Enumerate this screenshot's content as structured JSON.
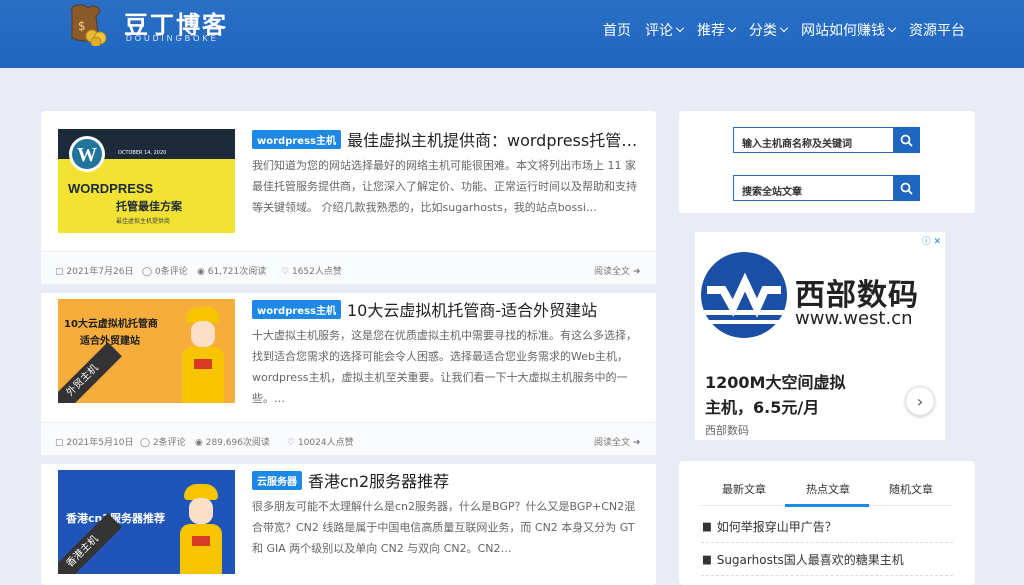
{
  "header": {
    "logo_title": "豆丁博客",
    "logo_sub": "DOUDINGBOKE",
    "nav": [
      {
        "label": "首页",
        "dropdown": false
      },
      {
        "label": "评论",
        "dropdown": true
      },
      {
        "label": "推荐",
        "dropdown": true
      },
      {
        "label": "分类",
        "dropdown": true
      },
      {
        "label": "网站如何赚钱",
        "dropdown": true
      },
      {
        "label": "资源平台",
        "dropdown": false
      }
    ]
  },
  "posts": [
    {
      "category": "wordpress主机",
      "title": "最佳虚拟主机提供商：wordpress托管最…",
      "excerpt": "我们知道为您的网站选择最好的网络主机可能很困难。本文将列出市场上 11 家最佳托管服务提供商，让您深入了解定价、功能、正常运行时间以及帮助和支持等关键领域。 介绍几款我熟悉的，比如sugarhosts，我的站点bossi…",
      "thumb": {
        "line1": "WORDPRESS",
        "line2": "托管最佳方案",
        "small_top": "OCTOBER 14, 2020",
        "small_bottom": "最佳虚拟主机提供商"
      },
      "date": "2021年7月26日",
      "comments": "0条评论",
      "views": "61,721次阅读",
      "likes": "1652人点赞",
      "read_more": "阅读全文"
    },
    {
      "category": "wordpress主机",
      "title": "10大云虚拟机托管商-适合外贸建站",
      "excerpt": "十大虚拟主机服务，这是您在优质虚拟主机中需要寻找的标准。有这么多选择，找到适合您需求的选择可能会令人困惑。选择最适合您业务需求的Web主机，wordpress主机，虚拟主机至关重要。让我们看一下十大虚拟主机服务中的一些。…",
      "thumb": {
        "line1": "10大云虚拟机托管商",
        "line2": "适合外贸建站",
        "ribbon": "外贸主机"
      },
      "date": "2021年5月10日",
      "comments": "2条评论",
      "views": "289,696次阅读",
      "likes": "10024人点赞",
      "read_more": "阅读全文"
    },
    {
      "category": "云服务器",
      "title": "香港cn2服务器推荐",
      "excerpt": "很多朋友可能不太理解什么是cn2服务器，什么是BGP？什么又是BGP+CN2混合带宽？CN2 线路是属于中国电信高质量互联网业务，而 CN2 本身又分为 GT 和 GIA 两个级别以及单向 CN2 与双向 CN2。CN2…",
      "thumb": {
        "line1": "香港cn2服务器推荐",
        "ribbon": "香港主机"
      }
    }
  ],
  "sidebar": {
    "search1_placeholder": "输入主机商名称及关键词",
    "search2_placeholder": "搜索全站文章",
    "ad": {
      "brand": "西部数码",
      "url": "www.west.cn",
      "headline": "1200M大空间虚拟主机，6.5元/月",
      "source": "西部数码"
    },
    "tabs": [
      "最新文章",
      "热点文章",
      "随机文章"
    ],
    "hot_posts": [
      "如何举报穿山甲广告？",
      "Sugarhosts国人最喜欢的糖果主机"
    ]
  },
  "colors": {
    "header_bg": "#1f66c0",
    "accent": "#1e88e5",
    "page_bg": "#e9ebf7"
  }
}
